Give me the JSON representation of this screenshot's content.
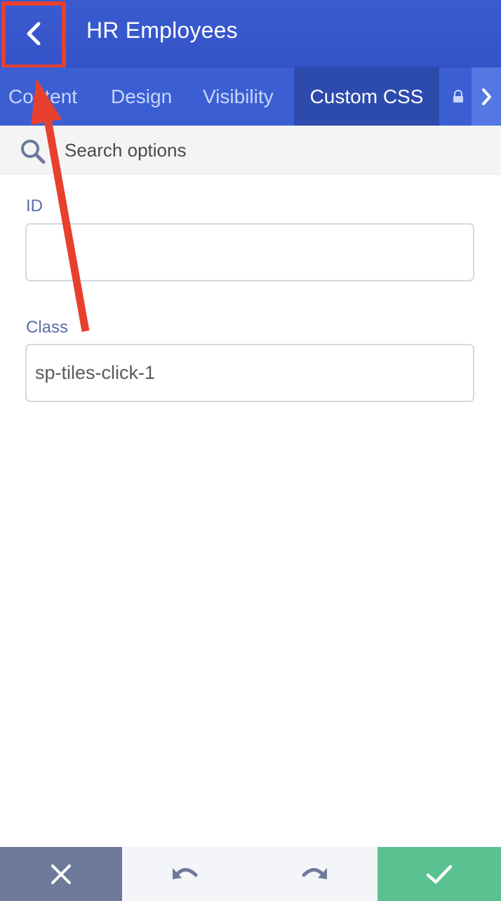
{
  "header": {
    "title": "HR Employees",
    "back_icon": "chevron-left-icon",
    "highlight_color": "#e8402e"
  },
  "tabs": [
    {
      "label": "Content",
      "active": false
    },
    {
      "label": "Design",
      "active": false
    },
    {
      "label": "Visibility",
      "active": false
    },
    {
      "label": "Custom CSS",
      "active": true
    },
    {
      "label": "",
      "icon": "lock-icon",
      "active": false
    }
  ],
  "tabs_next_icon": "chevron-right-icon",
  "search": {
    "placeholder": "Search options",
    "icon": "search-icon"
  },
  "fields": {
    "id": {
      "label": "ID",
      "value": ""
    },
    "class": {
      "label": "Class",
      "value": "sp-tiles-click-1"
    }
  },
  "footer": {
    "close_icon": "close-icon",
    "undo_icon": "undo-icon",
    "redo_icon": "redo-icon",
    "confirm_icon": "check-icon"
  },
  "annotation": {
    "arrow_color": "#e8402e"
  },
  "colors": {
    "header": "#3a5bd0",
    "tab_active": "#2d4aad",
    "confirm": "#5ac291",
    "cancel": "#6e7a99"
  }
}
